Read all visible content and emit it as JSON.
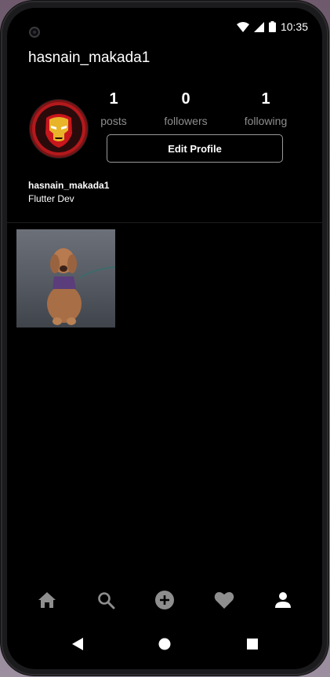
{
  "status_bar": {
    "time": "10:35",
    "icons": [
      "wifi-icon",
      "signal-icon",
      "battery-icon"
    ]
  },
  "profile": {
    "username": "hasnain_makada1",
    "avatar_icon": "iron-man-avatar",
    "stats": {
      "posts": {
        "count": "1",
        "label": "posts"
      },
      "followers": {
        "count": "0",
        "label": "followers"
      },
      "following": {
        "count": "1",
        "label": "following"
      }
    },
    "edit_button_label": "Edit Profile",
    "bio_name": "hasnain_makada1",
    "bio_text": "Flutter Dev"
  },
  "posts_grid": [
    {
      "thumbnail": "dog-photo"
    }
  ],
  "bottom_nav": [
    "home-icon",
    "search-icon",
    "add-circle-icon",
    "heart-icon",
    "profile-icon"
  ],
  "system_nav": [
    "back-icon",
    "home-circle-icon",
    "recents-icon"
  ],
  "colors": {
    "background": "#000000",
    "text_primary": "#ffffff",
    "text_secondary": "#8e8e8e",
    "nav_icon_inactive": "#8e8e8e",
    "nav_icon_active": "#ffffff",
    "button_border": "#9a9a9a"
  }
}
